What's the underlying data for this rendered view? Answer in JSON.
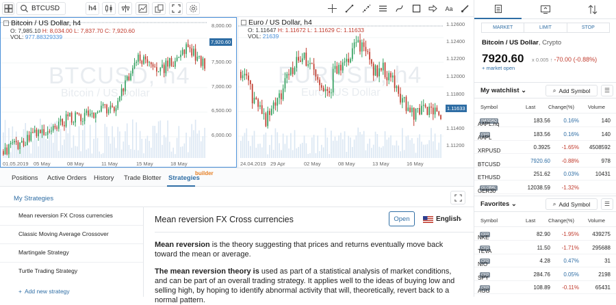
{
  "toolbar": {
    "symbol": "BTCUSD",
    "timeframe": "h4",
    "aa_label": "Aa"
  },
  "chart_btc": {
    "title": "Bitcoin / US Dollar, h4",
    "ohlc_o": "O: 7,985.10",
    "ohlc_h": "H: 8,034.00",
    "ohlc_l": "L: 7,837.70",
    "ohlc_c": "C: 7,920.60",
    "vol_label": "VOL:",
    "vol_value": "977.88329339",
    "watermark": "BTCUSD, h4",
    "watermark_sub": "Bitcoin / US Dollar",
    "price_ticks": [
      "8,000.00",
      "7,500.00",
      "7,000.00",
      "6,500.00",
      "6,000.00"
    ],
    "current_price": "7,920.60",
    "time_ticks": [
      "01.05.2019",
      "05 May",
      "08 May",
      "11 May",
      "15 May",
      "18 May"
    ]
  },
  "chart_eur": {
    "title": "Euro / US Dollar, h4",
    "ohlc_o": "O: 1.11647",
    "ohlc_h": "H: 1.11672",
    "ohlc_l": "L: 1.11629",
    "ohlc_c": "C: 1.11633",
    "vol_label": "VOL:",
    "vol_value": "21639",
    "watermark": "EURUSD, h4",
    "watermark_sub": "Euro / US Dollar",
    "price_ticks": [
      "1.12600",
      "1.12400",
      "1.12200",
      "1.12000",
      "1.11800",
      "1.11600",
      "1.11400",
      "1.11200"
    ],
    "current_price": "1.11633",
    "time_ticks": [
      "24.04.2019",
      "29 Apr",
      "02 May",
      "08 May",
      "13 May",
      "16 May"
    ]
  },
  "tabs": [
    "Positions",
    "Active Orders",
    "History",
    "Trade Blotter",
    "Strategies"
  ],
  "builder_badge": "builder",
  "strategies": {
    "heading": "My Strategies",
    "items": [
      "Mean reversion FX Cross currencies",
      "Classic Moving Average Crossover",
      "Martingale Strategy",
      "Turtle Trading Strategy"
    ],
    "add_label": "Add new strategy",
    "detail": {
      "title": "Mean reversion FX Cross currencies",
      "open_label": "Open",
      "language": "English",
      "p1_bold": "Mean reversion",
      "p1_rest": " is the theory suggesting that prices and returns eventually move back toward the mean or average.",
      "p2_bold": "The mean reversion theory is",
      "p2_rest": " used as part of a statistical analysis of market conditions, and can be part of an overall trading strategy. It applies well to the ideas of buying low and selling high, by hoping to identify abnormal activity that will, theoretically, revert back to a normal pattern."
    }
  },
  "right": {
    "order_types": [
      "MARKET",
      "LIMIT",
      "STOP"
    ],
    "instrument": "Bitcoin / US Dollar",
    "instrument_type": ", Crypto",
    "price": "7920.60",
    "price_extra": "x 0.005",
    "change": "-70.00 (-0.88%)",
    "market_status": "market open",
    "watchlist_title": "My watchlist",
    "favorites_title": "Favorites",
    "add_symbol": "Add Symbol",
    "columns": [
      "Symbol",
      "Last",
      "Change(%)",
      "Volume"
    ],
    "watchlist": [
      {
        "sym": "AAPL.nq",
        "tag": "NASDAQ",
        "last": "183.56",
        "chg": "0.16%",
        "vol": "140",
        "dir": "pos"
      },
      {
        "sym": "AAPL",
        "tag": "CFD",
        "last": "183.56",
        "chg": "0.16%",
        "vol": "140",
        "dir": "pos"
      },
      {
        "sym": "XRPUSD",
        "tag": "",
        "last": "0.3925",
        "chg": "-1.65%",
        "vol": "4508592",
        "dir": "neg"
      },
      {
        "sym": "BTCUSD",
        "tag": "",
        "last": "7920.60",
        "chg": "-0.88%",
        "vol": "978",
        "dir": "neg"
      },
      {
        "sym": "ETHUSD",
        "tag": "",
        "last": "251.62",
        "chg": "0.03%",
        "vol": "10431",
        "dir": "pos"
      },
      {
        "sym": "GER30",
        "tag": "GLOBAL",
        "last": "12038.59",
        "chg": "-1.32%",
        "vol": "",
        "dir": "neg"
      }
    ],
    "favorites": [
      {
        "sym": "NKE",
        "tag": "CFD",
        "last": "82.90",
        "chg": "-1.95%",
        "vol": "439275",
        "dir": "neg"
      },
      {
        "sym": "TEVA",
        "tag": "CFD",
        "last": "11.50",
        "chg": "-1.71%",
        "vol": "295688",
        "dir": "neg"
      },
      {
        "sym": "NIO",
        "tag": "CFD",
        "last": "4.28",
        "chg": "0.47%",
        "vol": "31",
        "dir": "pos"
      },
      {
        "sym": "SPY",
        "tag": "CFD",
        "last": "284.76",
        "chg": "0.05%",
        "vol": "2198",
        "dir": "pos"
      },
      {
        "sym": "AGG",
        "tag": "CFD",
        "last": "108.89",
        "chg": "-0.11%",
        "vol": "65431",
        "dir": "neg"
      }
    ]
  },
  "colors": {
    "accent": "#2e6da4",
    "up": "#2e9e5b",
    "down": "#c0392b"
  }
}
